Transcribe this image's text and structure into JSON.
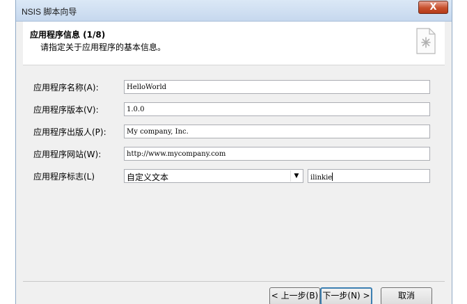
{
  "window": {
    "title": "NSIS 脚本向导",
    "close_label": "X"
  },
  "header": {
    "title": "应用程序信息 (1/8)",
    "subtitle": "请指定关于应用程序的基本信息。",
    "icon": "document-icon"
  },
  "form": {
    "app_name": {
      "label": "应用程序名称(A):",
      "value": "HelloWorld"
    },
    "app_version": {
      "label": "应用程序版本(V):",
      "value": "1.0.0"
    },
    "app_publisher": {
      "label": "应用程序出版人(P):",
      "value": "My company, Inc."
    },
    "app_website": {
      "label": "应用程序网站(W):",
      "value": "http://www.mycompany.com"
    },
    "app_brand": {
      "label": "应用程序标志(L)",
      "select_value": "自定义文本",
      "text_value": "ilinkie"
    }
  },
  "buttons": {
    "back": "< 上一步(B)",
    "next": "下一步(N) >",
    "cancel": "取消"
  }
}
